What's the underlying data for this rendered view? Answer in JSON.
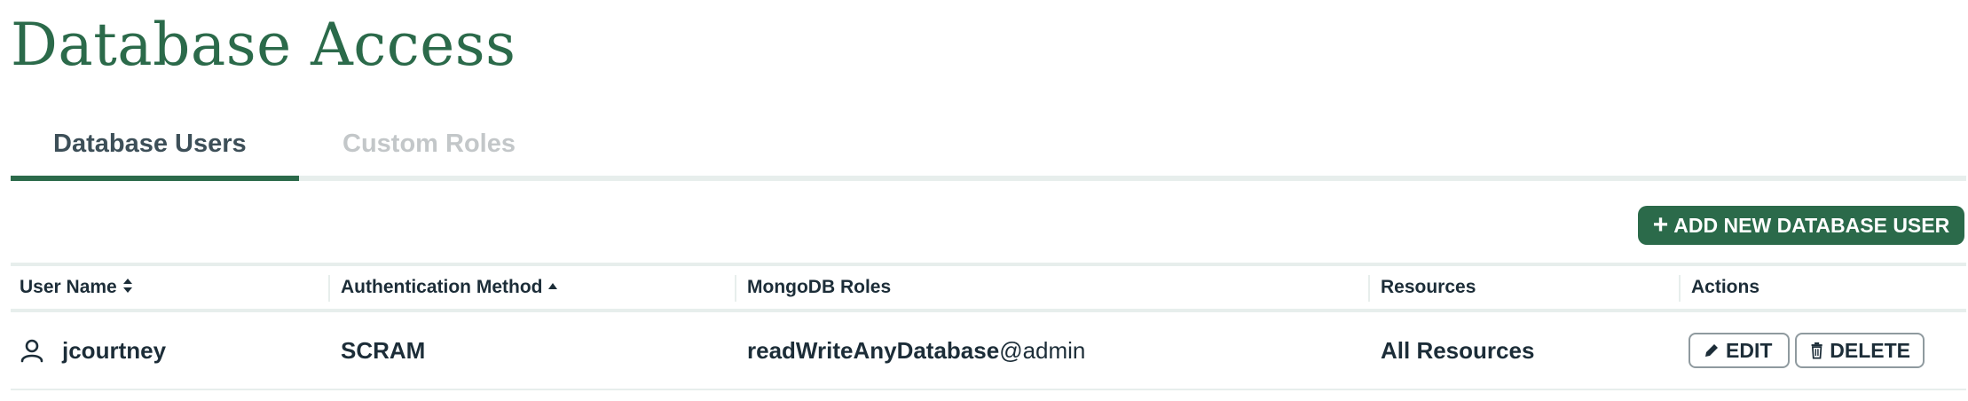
{
  "page": {
    "title": "Database Access"
  },
  "tabs": [
    {
      "label": "Database Users",
      "active": true
    },
    {
      "label": "Custom Roles",
      "active": false
    }
  ],
  "toolbar": {
    "add_button_label": "ADD NEW DATABASE USER",
    "add_icon": "plus-icon"
  },
  "table": {
    "columns": [
      {
        "label": "User Name",
        "sort": "sortable"
      },
      {
        "label": "Authentication Method",
        "sort": "ascending"
      },
      {
        "label": "MongoDB Roles",
        "sort": "none"
      },
      {
        "label": "Resources",
        "sort": "none"
      },
      {
        "label": "Actions",
        "sort": "none"
      }
    ],
    "rows": [
      {
        "user_name": "jcourtney",
        "auth_method": "SCRAM",
        "role_name": "readWriteAnyDatabase",
        "role_db": "@admin",
        "resources": "All Resources",
        "actions": {
          "edit": "EDIT",
          "delete": "DELETE"
        }
      }
    ]
  },
  "colors": {
    "brand": "#2b6a4a",
    "text": "#1c2d38",
    "muted": "#c3c7c9",
    "divider": "#e7eeec"
  }
}
